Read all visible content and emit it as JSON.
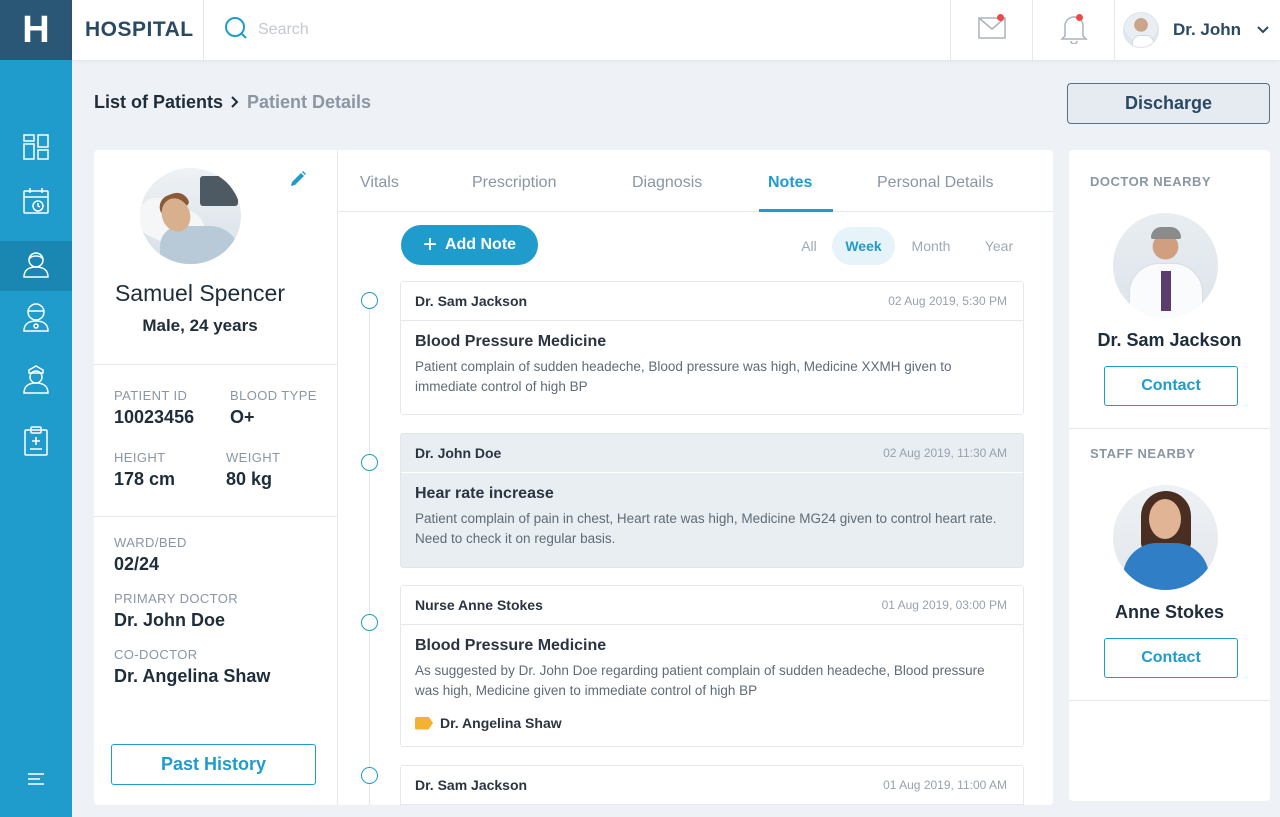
{
  "app": {
    "logo_letter": "H",
    "brand": "HOSPITAL"
  },
  "search": {
    "placeholder": "Search"
  },
  "user": {
    "name": "Dr. John"
  },
  "breadcrumb": {
    "root": "List of Patients",
    "current": "Patient Details"
  },
  "actions": {
    "discharge": "Discharge",
    "past_history": "Past History",
    "add_note": "Add Note"
  },
  "patient": {
    "name": "Samuel Spencer",
    "summary": "Male, 24 years",
    "id_label": "PATIENT ID",
    "id": "10023456",
    "blood_label": "BLOOD TYPE",
    "blood": "O+",
    "height_label": "HEIGHT",
    "height": "178 cm",
    "weight_label": "WEIGHT",
    "weight": "80 kg",
    "ward_label": "WARD/BED",
    "ward": "02/24",
    "primary_label": "PRIMARY DOCTOR",
    "primary": "Dr. John Doe",
    "co_label": "CO-DOCTOR",
    "co": "Dr. Angelina Shaw"
  },
  "tabs": [
    {
      "label": "Vitals"
    },
    {
      "label": "Prescription"
    },
    {
      "label": "Diagnosis"
    },
    {
      "label": "Notes",
      "active": true
    },
    {
      "label": "Personal Details"
    }
  ],
  "periods": [
    {
      "label": "All"
    },
    {
      "label": "Week",
      "active": true
    },
    {
      "label": "Month"
    },
    {
      "label": "Year"
    }
  ],
  "notes": [
    {
      "author": "Dr. Sam Jackson",
      "date": "02 Aug 2019, 5:30 PM",
      "title": "Blood Pressure Medicine",
      "text": "Patient complain of sudden headeche, Blood pressure was high, Medicine XXMH given to immediate control of high BP"
    },
    {
      "author": "Dr. John Doe",
      "date": "02 Aug 2019, 11:30 AM",
      "title": "Hear rate increase",
      "text": "Patient complain of pain in chest, Heart rate was high, Medicine MG24 given to control heart rate. Need to check it on regular basis."
    },
    {
      "author": "Nurse Anne Stokes",
      "date": "01 Aug 2019, 03:00 PM",
      "title": "Blood Pressure Medicine",
      "text": "As suggested by Dr. John Doe regarding patient complain of sudden headeche, Blood pressure was high, Medicine given to immediate control of high BP",
      "tag": "Dr. Angelina Shaw"
    },
    {
      "author": "Dr. Sam Jackson",
      "date": "01 Aug 2019, 11:00 AM"
    }
  ],
  "nearby": {
    "doctor_label": "DOCTOR NEARBY",
    "doctor_name": "Dr. Sam Jackson",
    "staff_label": "STAFF NEARBY",
    "staff_name": "Anne Stokes",
    "contact": "Contact"
  },
  "colors": {
    "accent": "#1f9ccb",
    "sidebar": "#1f9ccb",
    "logo_bg": "#2a5775",
    "notification": "#f04848",
    "tag": "#f4b233"
  },
  "icons": [
    "search-icon",
    "mail-icon",
    "bell-icon",
    "chevron-down-icon",
    "dashboard-icon",
    "calendar-icon",
    "patient-icon",
    "doctor-icon",
    "nurse-icon",
    "clipboard-icon",
    "menu-icon",
    "edit-icon",
    "plus-icon",
    "tag-icon"
  ]
}
